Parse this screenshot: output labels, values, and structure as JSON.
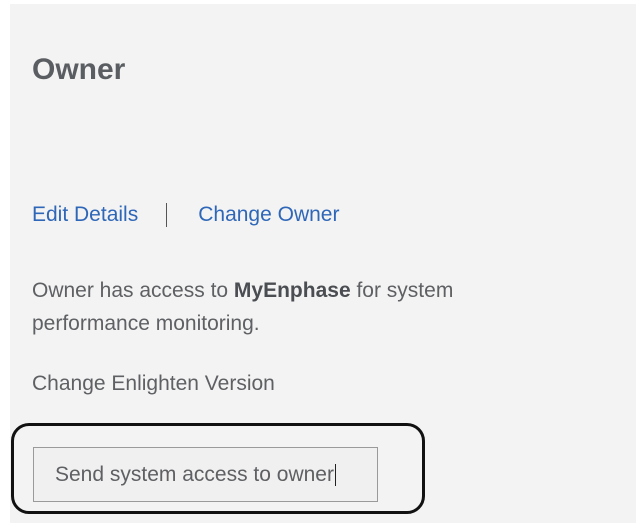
{
  "owner_panel": {
    "title": "Owner",
    "links": {
      "edit_details": "Edit Details",
      "change_owner": "Change Owner"
    },
    "description": {
      "prefix": "Owner has access to ",
      "product": "MyEnphase",
      "suffix": " for system performance monitoring."
    },
    "change_version_label": "Change Enlighten Version",
    "send_access_button": "Send system access to owner"
  },
  "colors": {
    "panel_background": "#f3f3f3",
    "link": "#2f67b8",
    "text": "#5e6063",
    "title": "#5a5d62",
    "highlight_outline": "#111111"
  }
}
